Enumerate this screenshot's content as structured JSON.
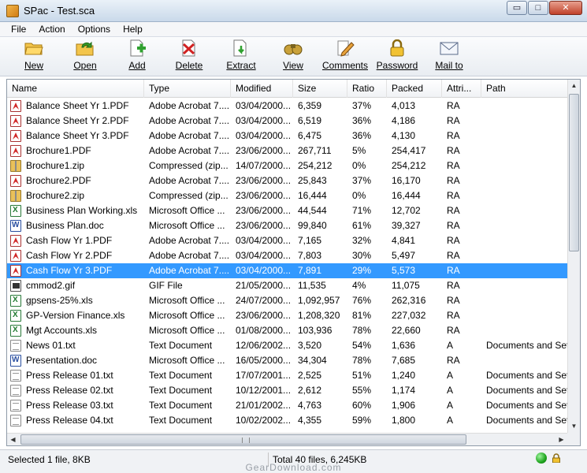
{
  "window": {
    "title": "SPac - Test.sca",
    "min_glyph": "▭",
    "max_glyph": "□",
    "close_glyph": "✕"
  },
  "menu": [
    "File",
    "Action",
    "Options",
    "Help"
  ],
  "toolbar": [
    {
      "label": "New",
      "icon": "folder-open-icon"
    },
    {
      "label": "Open",
      "icon": "open-folder-arrow-icon"
    },
    {
      "label": "Add",
      "icon": "add-document-icon"
    },
    {
      "label": "Delete",
      "icon": "delete-document-icon"
    },
    {
      "label": "Extract",
      "icon": "extract-document-icon"
    },
    {
      "label": "View",
      "icon": "binoculars-icon"
    },
    {
      "label": "Comments",
      "icon": "pencil-note-icon"
    },
    {
      "label": "Password",
      "icon": "padlock-icon"
    },
    {
      "label": "Mail to",
      "icon": "envelope-icon"
    }
  ],
  "columns": [
    "Name",
    "Type",
    "Modified",
    "Size",
    "Ratio",
    "Packed",
    "Attri...",
    "Path"
  ],
  "rows": [
    {
      "icon": "pdf",
      "name": "Balance Sheet Yr 1.PDF",
      "type": "Adobe Acrobat 7....",
      "modified": "03/04/2000...",
      "size": "6,359",
      "ratio": "37%",
      "packed": "4,013",
      "attr": "RA",
      "path": ""
    },
    {
      "icon": "pdf",
      "name": "Balance Sheet Yr 2.PDF",
      "type": "Adobe Acrobat 7....",
      "modified": "03/04/2000...",
      "size": "6,519",
      "ratio": "36%",
      "packed": "4,186",
      "attr": "RA",
      "path": ""
    },
    {
      "icon": "pdf",
      "name": "Balance Sheet Yr 3.PDF",
      "type": "Adobe Acrobat 7....",
      "modified": "03/04/2000...",
      "size": "6,475",
      "ratio": "36%",
      "packed": "4,130",
      "attr": "RA",
      "path": ""
    },
    {
      "icon": "pdf",
      "name": "Brochure1.PDF",
      "type": "Adobe Acrobat 7....",
      "modified": "23/06/2000...",
      "size": "267,711",
      "ratio": "5%",
      "packed": "254,417",
      "attr": "RA",
      "path": ""
    },
    {
      "icon": "zip",
      "name": "Brochure1.zip",
      "type": "Compressed (zip...",
      "modified": "14/07/2000...",
      "size": "254,212",
      "ratio": "0%",
      "packed": "254,212",
      "attr": "RA",
      "path": ""
    },
    {
      "icon": "pdf",
      "name": "Brochure2.PDF",
      "type": "Adobe Acrobat 7....",
      "modified": "23/06/2000...",
      "size": "25,843",
      "ratio": "37%",
      "packed": "16,170",
      "attr": "RA",
      "path": ""
    },
    {
      "icon": "zip",
      "name": "Brochure2.zip",
      "type": "Compressed (zip...",
      "modified": "23/06/2000...",
      "size": "16,444",
      "ratio": "0%",
      "packed": "16,444",
      "attr": "RA",
      "path": ""
    },
    {
      "icon": "xls",
      "name": "Business Plan Working.xls",
      "type": "Microsoft Office ...",
      "modified": "23/06/2000...",
      "size": "44,544",
      "ratio": "71%",
      "packed": "12,702",
      "attr": "RA",
      "path": ""
    },
    {
      "icon": "doc",
      "name": "Business Plan.doc",
      "type": "Microsoft Office ...",
      "modified": "23/06/2000...",
      "size": "99,840",
      "ratio": "61%",
      "packed": "39,327",
      "attr": "RA",
      "path": ""
    },
    {
      "icon": "pdf",
      "name": "Cash Flow Yr 1.PDF",
      "type": "Adobe Acrobat 7....",
      "modified": "03/04/2000...",
      "size": "7,165",
      "ratio": "32%",
      "packed": "4,841",
      "attr": "RA",
      "path": ""
    },
    {
      "icon": "pdf",
      "name": "Cash Flow Yr 2.PDF",
      "type": "Adobe Acrobat 7....",
      "modified": "03/04/2000...",
      "size": "7,803",
      "ratio": "30%",
      "packed": "5,497",
      "attr": "RA",
      "path": ""
    },
    {
      "icon": "pdf",
      "name": "Cash Flow Yr 3.PDF",
      "type": "Adobe Acrobat 7....",
      "modified": "03/04/2000...",
      "size": "7,891",
      "ratio": "29%",
      "packed": "5,573",
      "attr": "RA",
      "path": "",
      "selected": true
    },
    {
      "icon": "gif",
      "name": "cmmod2.gif",
      "type": "GIF File",
      "modified": "21/05/2000...",
      "size": "11,535",
      "ratio": "4%",
      "packed": "11,075",
      "attr": "RA",
      "path": ""
    },
    {
      "icon": "xls",
      "name": "gpsens-25%.xls",
      "type": "Microsoft Office ...",
      "modified": "24/07/2000...",
      "size": "1,092,957",
      "ratio": "76%",
      "packed": "262,316",
      "attr": "RA",
      "path": ""
    },
    {
      "icon": "xls",
      "name": "GP-Version Finance.xls",
      "type": "Microsoft Office ...",
      "modified": "23/06/2000...",
      "size": "1,208,320",
      "ratio": "81%",
      "packed": "227,032",
      "attr": "RA",
      "path": ""
    },
    {
      "icon": "xls",
      "name": "Mgt Accounts.xls",
      "type": "Microsoft Office ...",
      "modified": "01/08/2000...",
      "size": "103,936",
      "ratio": "78%",
      "packed": "22,660",
      "attr": "RA",
      "path": ""
    },
    {
      "icon": "txt",
      "name": "News 01.txt",
      "type": "Text Document",
      "modified": "12/06/2002...",
      "size": "3,520",
      "ratio": "54%",
      "packed": "1,636",
      "attr": "A",
      "path": "Documents and Set"
    },
    {
      "icon": "doc",
      "name": "Presentation.doc",
      "type": "Microsoft Office ...",
      "modified": "16/05/2000...",
      "size": "34,304",
      "ratio": "78%",
      "packed": "7,685",
      "attr": "RA",
      "path": ""
    },
    {
      "icon": "txt",
      "name": "Press Release 01.txt",
      "type": "Text Document",
      "modified": "17/07/2001...",
      "size": "2,525",
      "ratio": "51%",
      "packed": "1,240",
      "attr": "A",
      "path": "Documents and Set"
    },
    {
      "icon": "txt",
      "name": "Press Release 02.txt",
      "type": "Text Document",
      "modified": "10/12/2001...",
      "size": "2,612",
      "ratio": "55%",
      "packed": "1,174",
      "attr": "A",
      "path": "Documents and Set"
    },
    {
      "icon": "txt",
      "name": "Press Release 03.txt",
      "type": "Text Document",
      "modified": "21/01/2002...",
      "size": "4,763",
      "ratio": "60%",
      "packed": "1,906",
      "attr": "A",
      "path": "Documents and Set"
    },
    {
      "icon": "txt",
      "name": "Press Release 04.txt",
      "type": "Text Document",
      "modified": "10/02/2002...",
      "size": "4,355",
      "ratio": "59%",
      "packed": "1,800",
      "attr": "A",
      "path": "Documents and Set"
    }
  ],
  "status": {
    "left": "Selected 1 file, 8KB",
    "middle": "Total 40 files, 6,245KB"
  },
  "watermark": "GearDownload.com",
  "colors": {
    "selection": "#3399ff",
    "pdf": "#d12626",
    "xls": "#1f7a2f",
    "doc": "#2a4fa0",
    "led": "#1ea41e"
  }
}
